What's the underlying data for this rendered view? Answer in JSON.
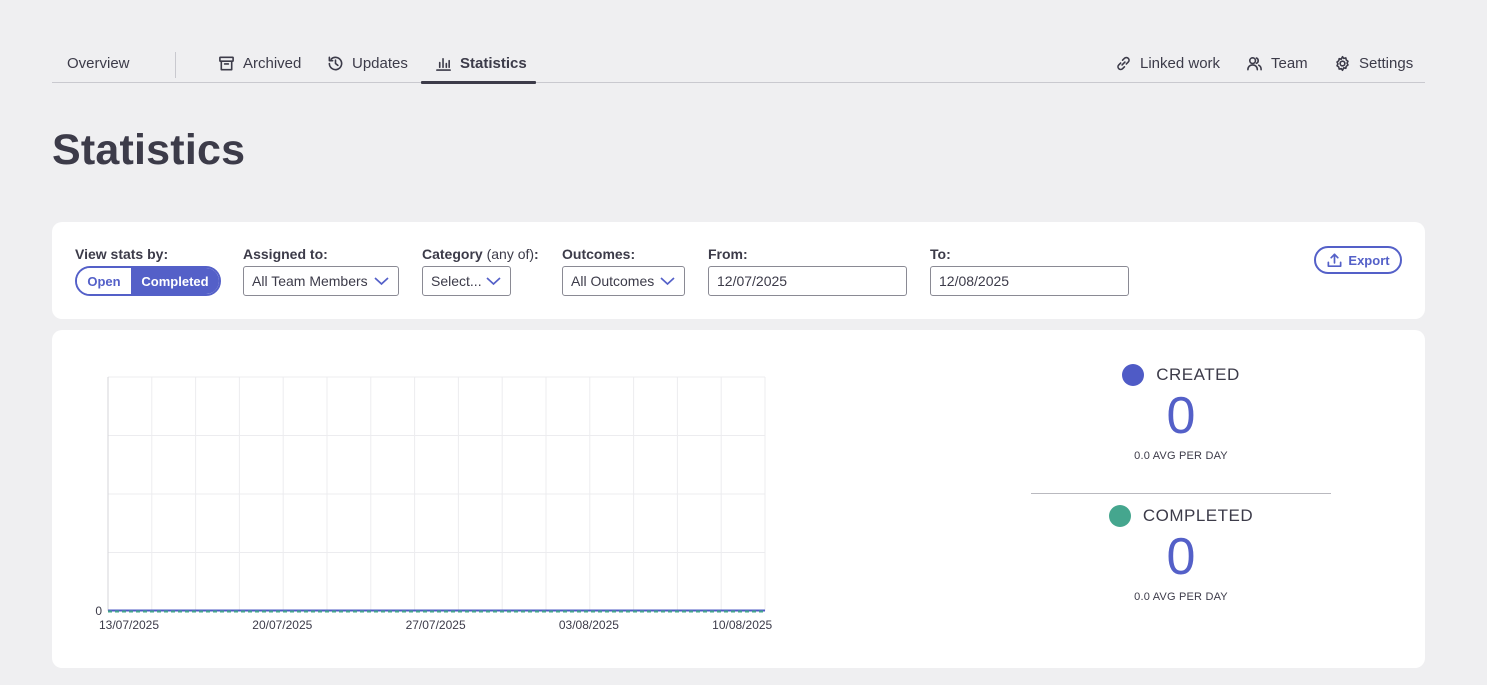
{
  "nav": {
    "overview": "Overview",
    "archived": "Archived",
    "updates": "Updates",
    "statistics": "Statistics",
    "linked_work": "Linked work",
    "team": "Team",
    "settings": "Settings"
  },
  "page": {
    "title": "Statistics"
  },
  "filters": {
    "view_stats_label": "View stats by:",
    "toggle_open": "Open",
    "toggle_completed": "Completed",
    "toggle_selected": "Completed",
    "assigned_label": "Assigned to:",
    "assigned_value": "All Team Members",
    "category_label": "Category",
    "category_label_extra": "(any of)",
    "category_label_colon": ":",
    "category_value": "Select...",
    "outcomes_label": "Outcomes:",
    "outcomes_value": "All Outcomes",
    "from_label": "From:",
    "from_value": "12/07/2025",
    "to_label": "To:",
    "to_value": "12/08/2025",
    "export_label": "Export"
  },
  "chart_data": {
    "type": "line",
    "x_tick_labels": [
      "13/07/2025",
      "20/07/2025",
      "27/07/2025",
      "03/08/2025",
      "10/08/2025"
    ],
    "y_tick_labels": [
      "0"
    ],
    "x": [
      "13/07/2025",
      "14/07/2025",
      "15/07/2025",
      "16/07/2025",
      "17/07/2025",
      "18/07/2025",
      "19/07/2025",
      "20/07/2025",
      "21/07/2025",
      "22/07/2025",
      "23/07/2025",
      "24/07/2025",
      "25/07/2025",
      "26/07/2025",
      "27/07/2025",
      "28/07/2025",
      "29/07/2025",
      "30/07/2025",
      "31/07/2025",
      "01/08/2025",
      "02/08/2025",
      "03/08/2025",
      "04/08/2025",
      "05/08/2025",
      "06/08/2025",
      "07/08/2025",
      "08/08/2025",
      "09/08/2025",
      "10/08/2025",
      "11/08/2025",
      "12/08/2025"
    ],
    "series": [
      {
        "name": "CREATED",
        "color": "#4f5bc6",
        "values": [
          0,
          0,
          0,
          0,
          0,
          0,
          0,
          0,
          0,
          0,
          0,
          0,
          0,
          0,
          0,
          0,
          0,
          0,
          0,
          0,
          0,
          0,
          0,
          0,
          0,
          0,
          0,
          0,
          0,
          0,
          0
        ]
      },
      {
        "name": "COMPLETED",
        "color": "#45a68e",
        "values": [
          0,
          0,
          0,
          0,
          0,
          0,
          0,
          0,
          0,
          0,
          0,
          0,
          0,
          0,
          0,
          0,
          0,
          0,
          0,
          0,
          0,
          0,
          0,
          0,
          0,
          0,
          0,
          0,
          0,
          0,
          0
        ]
      }
    ],
    "ylim": [
      0,
      4
    ],
    "grid": true,
    "legend": "right"
  },
  "stats": {
    "created": {
      "label": "CREATED",
      "value": "0",
      "sub": "0.0 AVG PER DAY",
      "color": "#4f5bc6"
    },
    "completed": {
      "label": "COMPLETED",
      "value": "0",
      "sub": "0.0 AVG PER DAY",
      "color": "#45a68e"
    }
  },
  "colors": {
    "accent": "#5460c8",
    "text": "#3c3b49",
    "background": "#efeff1"
  }
}
